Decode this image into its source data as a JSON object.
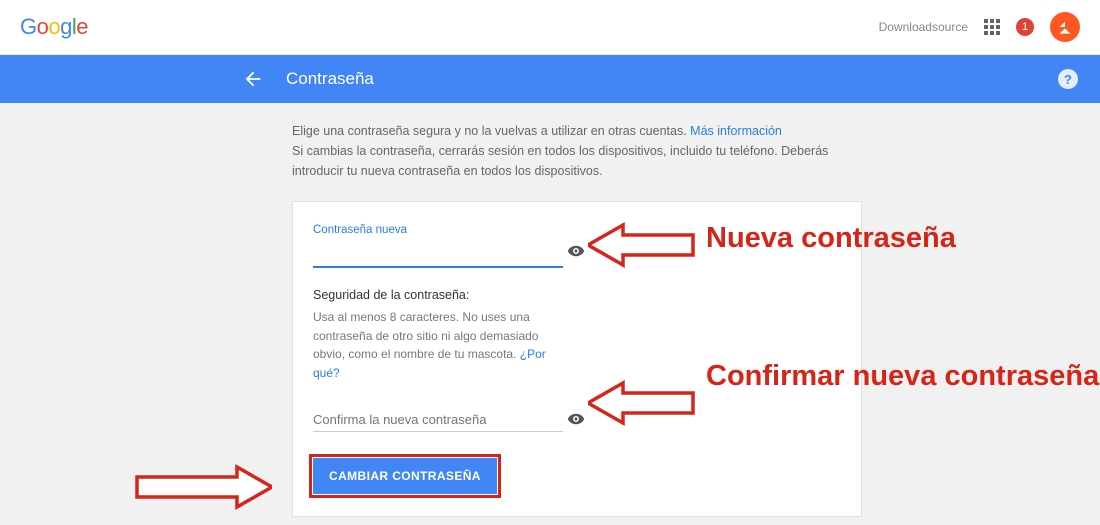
{
  "header": {
    "download_source": "Downloadsource",
    "notif_count": "1"
  },
  "bluebar": {
    "title": "Contraseña"
  },
  "intro": {
    "line1": "Elige una contraseña segura y no la vuelvas a utilizar en otras cuentas.",
    "more_info": "Más información",
    "line2": "Si cambias la contraseña, cerrarás sesión en todos los dispositivos, incluido tu teléfono. Deberás introducir tu nueva contraseña en todos los dispositivos."
  },
  "form": {
    "new_label": "Contraseña nueva",
    "strength_title": "Seguridad de la contraseña:",
    "strength_help": "Usa al menos 8 caracteres. No uses una contraseña de otro sitio ni algo demasiado obvio, como el nombre de tu mascota.",
    "why_link": "¿Por qué?",
    "confirm_placeholder": "Confirma la nueva contraseña",
    "button_label": "CAMBIAR CONTRASEÑA"
  },
  "annotations": {
    "new_pw": "Nueva contraseña",
    "confirm_pw": "Confirmar nueva contraseña"
  }
}
